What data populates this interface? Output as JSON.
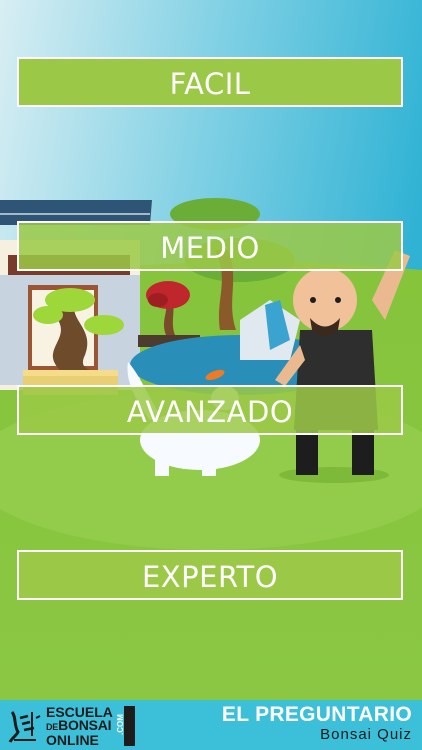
{
  "levels": {
    "facil": "FACIL",
    "medio": "MEDIO",
    "avanzado": "AVANZADO",
    "experto": "EXPERTO"
  },
  "footer": {
    "school_line1": "ESCUELA",
    "school_line2_prefix": "DE",
    "school_line2_main": "BONSAI",
    "school_line3": "ONLINE",
    "school_domain": ".COM",
    "app_title": "EL PREGUNTARIO",
    "app_subtitle": "Bonsai Quiz"
  },
  "colors": {
    "button_green": "#9bc947",
    "grass": "#8cc63f",
    "sky": "#3cb9d6",
    "footer_bg": "#3cc0d9"
  }
}
